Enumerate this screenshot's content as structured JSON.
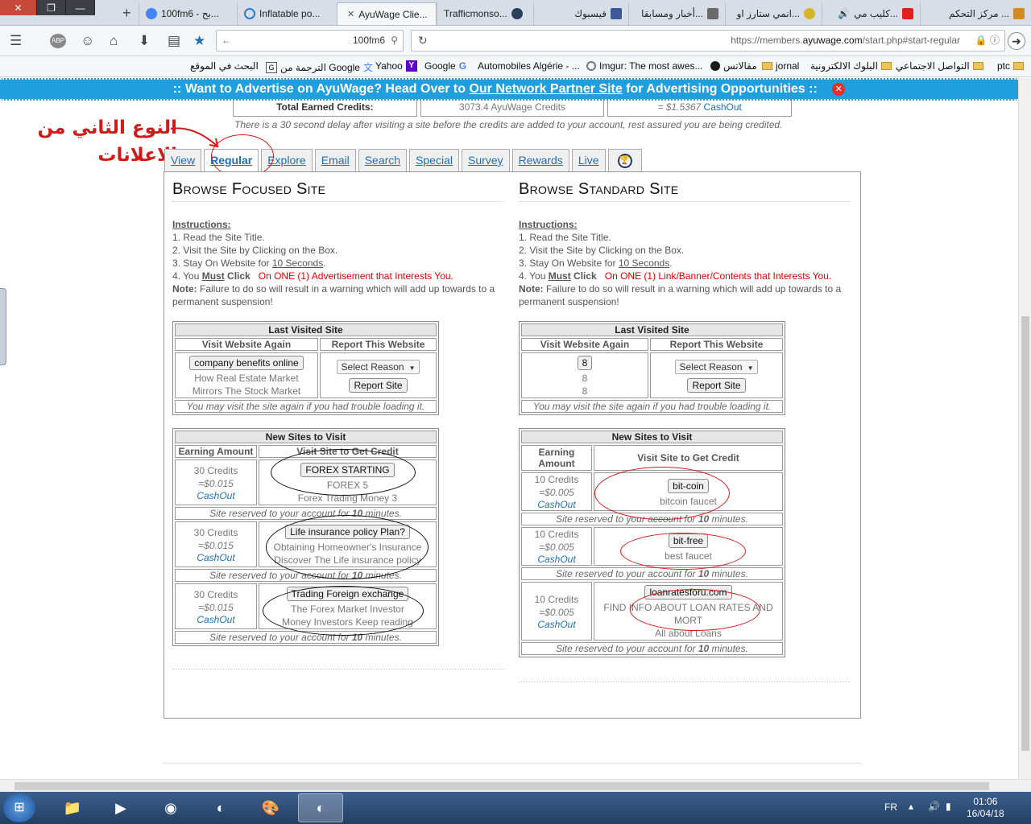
{
  "browser": {
    "tabs": [
      {
        "label": "مركز التحكم ...",
        "icon_color": "#d08a2a"
      },
      {
        "label": "كليب مي...",
        "icon_color": "#e02020"
      },
      {
        "label": "انمي ستارز او...",
        "icon_color": "#d6b52a"
      },
      {
        "label": "أخبار ومسابقا...",
        "icon_color": "#6a6a6a"
      },
      {
        "label": "فيسبوك",
        "icon_color": "#3b5998"
      },
      {
        "label": "Trafficmonso...",
        "icon_color": "#2a3f5a"
      },
      {
        "label": "AyuWage Clie...",
        "icon_color": "#2d6bb5",
        "active": true
      },
      {
        "label": "Inflatable po...",
        "icon_color": "#2a7bd6"
      },
      {
        "label": "100fm6 - بح...",
        "icon_color": "#4285f4"
      }
    ],
    "new_tab": "+",
    "window_controls": {
      "close": "✕",
      "restore": "❐",
      "minimize": "—"
    },
    "search_value": "100fm6",
    "url": {
      "prefix": "https://members.",
      "domain": "ayuwage.com",
      "path": "/start.php#start-regular"
    },
    "bookmarks": [
      {
        "label": "ptc",
        "type": "folder"
      },
      {
        "label": "التواصل الاجتماعي",
        "type": "folder"
      },
      {
        "label": "البلوك الالكترونية",
        "type": "folder"
      },
      {
        "label": "jornal",
        "type": "folder"
      },
      {
        "label": "مقالاتس",
        "type": "site"
      },
      {
        "label": "Imgur: The most awes...",
        "type": "site"
      },
      {
        "label": "Automobiles Algérie - ...",
        "type": "site"
      },
      {
        "label": "Google",
        "type": "site"
      },
      {
        "label": "Yahoo",
        "type": "site"
      },
      {
        "label": "الترجمة من Google",
        "type": "site"
      },
      {
        "label": "البحث في الموقع",
        "type": "site"
      }
    ]
  },
  "ad_banner": {
    "prefix": ":: Want to Advertise on AyuWage? Head Over to ",
    "link": "Our Network Partner Site",
    "suffix": " for Advertising Opportunities ::",
    "close_icon": "✕"
  },
  "credits": {
    "label": "Total Earned Credits:",
    "value": "3073.4 AyuWage Credits",
    "cash_prefix": "= $1.5367 ",
    "cash_link": "CashOut"
  },
  "delay_note": "There is a 30 second delay after visiting a site before the credits are added to your account, rest assured you are being credited.",
  "annotation": {
    "line1": "النوع الثاني من",
    "line2": "الاعلانات"
  },
  "page_tabs": [
    "View",
    "Regular",
    "Explore",
    "Email",
    "Search",
    "Special",
    "Survey",
    "Rewards",
    "Live"
  ],
  "focused": {
    "title": "Browse Focused Site",
    "instructions": {
      "head": "Instructions:",
      "i1": "1. Read the Site Title.",
      "i2": "2. Visit the Site by Clicking on the Box.",
      "i3a": "3. Stay On Website for ",
      "i3b": "10 Seconds",
      "i3c": ".",
      "i4a": "4. You ",
      "i4b": "Must",
      "i4c": " Click",
      "i4d": "On ONE (1) Advertisement that Interests You.",
      "note_head": "Note:",
      "note": " Failure to do so will result in a warning which will add up towards to a permanent suspension!"
    },
    "last_visited": {
      "title": "Last Visited Site",
      "col1": "Visit Website Again",
      "col2": "Report This Website",
      "site_button": "company benefits online",
      "site_desc1": "How Real Estate Market",
      "site_desc2": "Mirrors The Stock Market",
      "select": "Select Reason",
      "report": "Report Site",
      "note": "You may visit the site again if you had trouble loading it."
    },
    "new_sites": {
      "title": "New Sites to Visit",
      "col1": "Earning Amount",
      "col2": "Visit Site to Get Credit",
      "reserved_a": "Site reserved to your account for ",
      "reserved_b": "10",
      "reserved_c": " minutes.",
      "rows": [
        {
          "credits": "30 Credits",
          "usd": "=$0.015",
          "cash": "CashOut",
          "button": "FOREX STARTING",
          "desc1": "FOREX 5",
          "desc2": "Forex Trading Money 3"
        },
        {
          "credits": "30 Credits",
          "usd": "=$0.015",
          "cash": "CashOut",
          "button": "Life insurance policy Plan?",
          "desc1": "Obtaining Homeowner's Insurance",
          "desc2": "Discover The Life insurance policy"
        },
        {
          "credits": "30 Credits",
          "usd": "=$0.015",
          "cash": "CashOut",
          "button": "Trading Foreign exchange",
          "desc1": "The Forex Market Investor",
          "desc2": "Money Investors Keep reading"
        }
      ]
    }
  },
  "standard": {
    "title": "Browse Standard Site",
    "instructions": {
      "head": "Instructions:",
      "i1": "1. Read the Site Title.",
      "i2": "2. Visit the Site by Clicking on the Box.",
      "i3a": "3. Stay On Website for ",
      "i3b": "10 Seconds",
      "i3c": ".",
      "i4a": "4. You ",
      "i4b": "Must",
      "i4c": " Click",
      "i4d": "On ONE (1) Link/Banner/Contents that Interests You.",
      "note_head": "Note:",
      "note": " Failure to do so will result in a warning which will add up towards to a permanent suspension!"
    },
    "last_visited": {
      "title": "Last Visited Site",
      "col1": "Visit Website Again",
      "col2": "Report This Website",
      "site_button": "8",
      "site_desc1": "8",
      "site_desc2": "8",
      "select": "Select Reason",
      "report": "Report Site",
      "note": "You may visit the site again if you had trouble loading it."
    },
    "new_sites": {
      "title": "New Sites to Visit",
      "col1": "Earning Amount",
      "col2": "Visit Site to Get Credit",
      "reserved_a": "Site reserved to your account for ",
      "reserved_b": "10",
      "reserved_c": " minutes.",
      "rows": [
        {
          "credits": "10 Credits",
          "usd": "=$0.005",
          "cash": "CashOut",
          "button": "bit-coin",
          "desc1": "bitcoin faucet",
          "desc2": ""
        },
        {
          "credits": "10 Credits",
          "usd": "=$0.005",
          "cash": "CashOut",
          "button": "bit-free",
          "desc1": "best faucet",
          "desc2": ""
        },
        {
          "credits": "10 Credits",
          "usd": "=$0.005",
          "cash": "CashOut",
          "button": "loanratesforu.com",
          "desc1": "FIND INFO ABOUT LOAN RATES AND MORT",
          "desc2": "All about Loans"
        }
      ]
    }
  },
  "taskbar": {
    "lang": "FR",
    "time": "01:06",
    "date": "16/04/18"
  }
}
